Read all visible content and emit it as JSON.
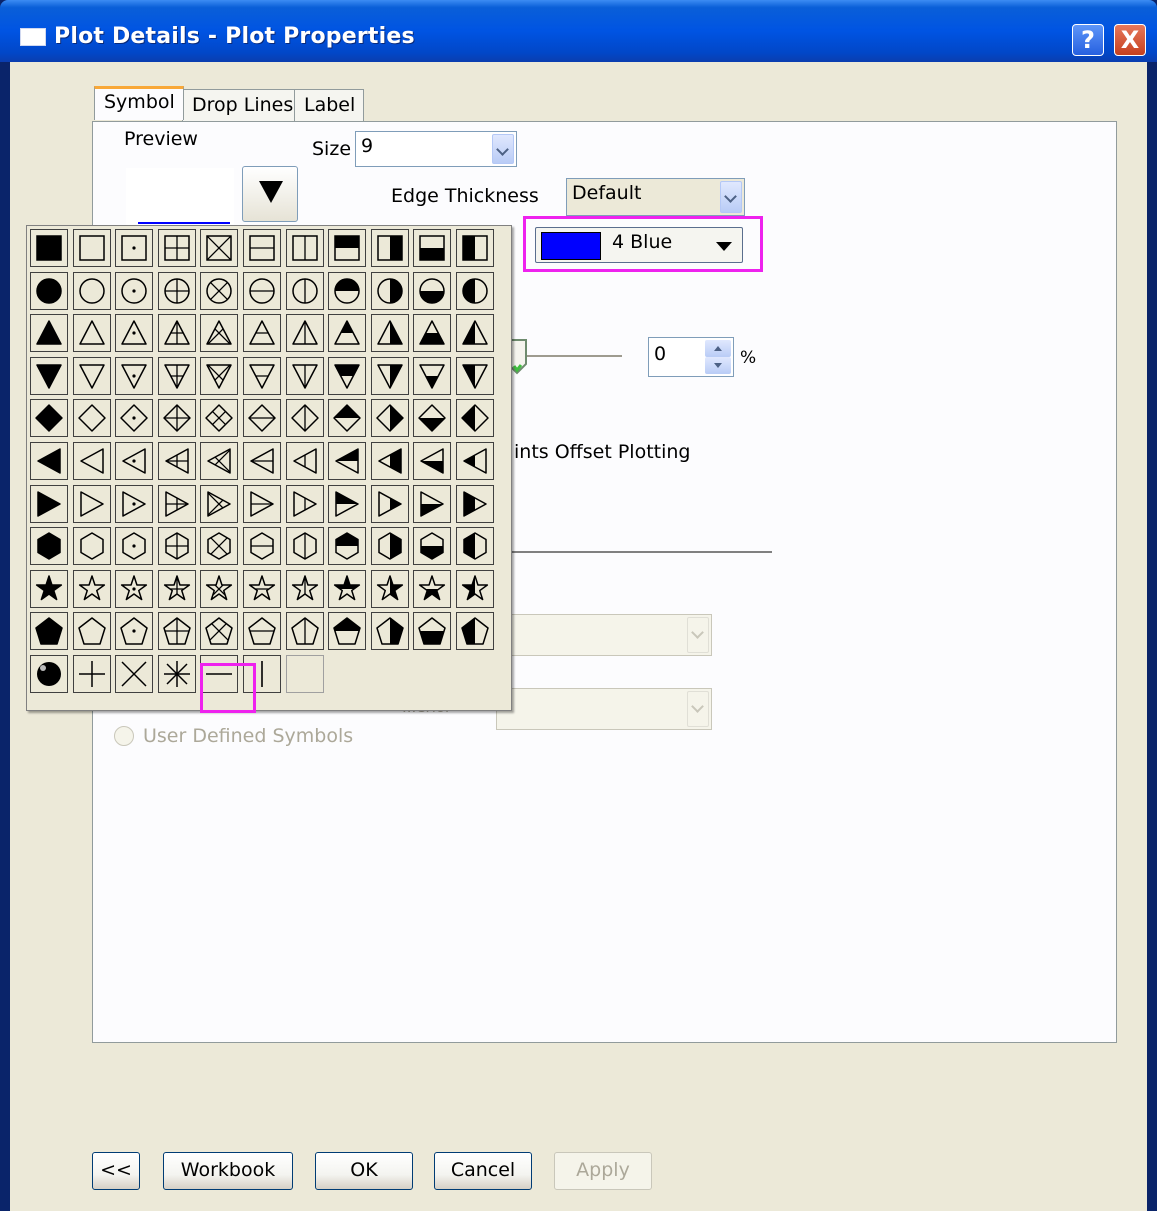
{
  "window": {
    "title": "Plot Details - Plot Properties",
    "help_glyph": "?",
    "close_glyph": "X"
  },
  "tabs": [
    {
      "label": "Symbol",
      "active": true
    },
    {
      "label": "Drop Lines",
      "active": false
    },
    {
      "label": "Label",
      "active": false
    }
  ],
  "symbol_tab": {
    "preview_label": "Preview",
    "size_label": "Size",
    "size_value": "9",
    "edge_thickness_label": "Edge Thickness",
    "edge_thickness_value": "Default",
    "color_value": "4 Blue",
    "color_hex": "#0000FF",
    "transparency_value": "0",
    "percent_label": "%",
    "offset_text": "ints Offset Plotting",
    "user_defined_label": "User Defined Symbols",
    "hidden_field_label": "...erior"
  },
  "symbol_gallery": {
    "rows": 11,
    "cols": 11,
    "shapes": [
      "square",
      "circle",
      "triangle-up",
      "triangle-down",
      "diamond",
      "triangle-left",
      "triangle-right",
      "hexagon",
      "star",
      "pentagon"
    ],
    "variants": [
      "solid",
      "open",
      "dot-center",
      "plus",
      "x",
      "hbar",
      "vbar",
      "top-half",
      "right-half",
      "bottom-half",
      "left-half"
    ],
    "extras": [
      "sphere",
      "plus",
      "x",
      "asterisk",
      "hline",
      "vline",
      "empty"
    ],
    "selected": "hline"
  },
  "footer_buttons": {
    "collapse": "<<",
    "workbook": "Workbook",
    "ok": "OK",
    "cancel": "Cancel",
    "apply": "Apply"
  },
  "colors": {
    "highlight": "#EE22EE",
    "title_bar": "#0054E3",
    "dialog_bg": "#ECE9D8"
  }
}
